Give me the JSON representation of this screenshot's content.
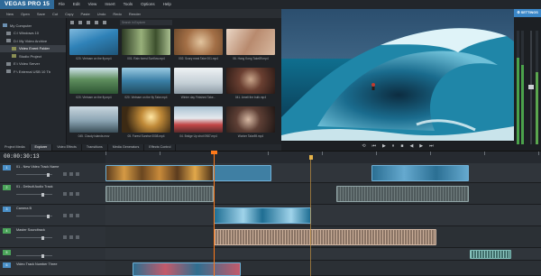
{
  "app": {
    "title": "VEGAS PRO 15"
  },
  "menu": [
    "File",
    "Edit",
    "View",
    "Insert",
    "Tools",
    "Options",
    "Help"
  ],
  "toolbar": [
    "New",
    "Open",
    "Save",
    "Cut",
    "Copy",
    "Paste",
    "Undo",
    "Redo",
    "Render"
  ],
  "explorer": {
    "search_placeholder": "Search in Explorer",
    "tree": [
      {
        "label": "My Computer",
        "icon": "computer-icon"
      },
      {
        "label": "C:\\ Windows 10",
        "icon": "drive-icon"
      },
      {
        "label": "D:\\ My Video Archive",
        "icon": "drive-icon"
      },
      {
        "label": "Video Event Folder",
        "icon": "folder-icon",
        "selected": true
      },
      {
        "label": "Studio Project",
        "icon": "folder-icon"
      },
      {
        "label": "E:\\ Video Server",
        "icon": "drive-icon"
      },
      {
        "label": "F:\\ External USB 10 Tb",
        "icon": "drive-icon"
      }
    ],
    "thumbnails": [
      {
        "caption": "020. Vietnam on the fly.mp4",
        "color": "#2f82b8"
      },
      {
        "caption": "001. Rain forest Sunflow.mp4",
        "color": "#5f7a48"
      },
      {
        "caption": "002. Scary meal Take 001.mp4",
        "color": "#a36f46"
      },
      {
        "caption": "06. Hong Kong Take89.mp4",
        "color": "#b88a6e"
      },
      {
        "caption": "020. Vietnam on the fly.mp4",
        "color": "#3b6d45"
      },
      {
        "caption": "020. Vietnam on the fly Take.mp4",
        "color": "#3a7fa6"
      },
      {
        "caption": "Winter day Finished Take...",
        "color": "#d6dee3"
      },
      {
        "caption": "041. Ameli the bulb.mp4",
        "color": "#4a2f26"
      },
      {
        "caption": "045. Cloudy islands.mov",
        "color": "#8aa3b2"
      },
      {
        "caption": "05. Forest Sunrise 0008.mp4",
        "color": "#8a5e28"
      },
      {
        "caption": "04. Bridge Up shot 0987.mp4",
        "color": "#7a3232"
      },
      {
        "caption": "Worker Take89.mp4",
        "color": "#3e2d29"
      }
    ]
  },
  "tabs": [
    "Project Media",
    "Explorer",
    "Video Effects",
    "Transitions",
    "Media Generators",
    "Effects Control"
  ],
  "active_tab": "Explorer",
  "preview": {
    "settings_label": "SETTINGS"
  },
  "timeline": {
    "timecode": "00:00:30:13",
    "tracks": [
      {
        "num": "1",
        "name": "01 - New Video Track Name",
        "type": "video"
      },
      {
        "num": "2",
        "name": "01 - Default Audio Track",
        "type": "audio"
      },
      {
        "num": "3",
        "name": "Camera B",
        "type": "video"
      },
      {
        "num": "4",
        "name": "Master Soundtrack",
        "type": "audio"
      },
      {
        "num": "5",
        "name": "",
        "type": "audio"
      },
      {
        "num": "6",
        "name": "Video Track Number Three",
        "type": "video"
      }
    ]
  },
  "colors": {
    "accent": "#2f6a99",
    "cursor": "#ff7a1a",
    "settings": "#3a86c7"
  }
}
